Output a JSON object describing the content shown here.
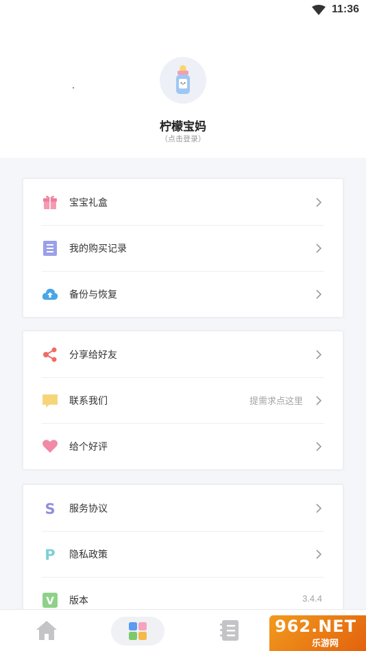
{
  "status_bar": {
    "time": "11:36"
  },
  "profile": {
    "name": "柠檬宝妈",
    "login_hint": "（点击登录）"
  },
  "groups": [
    {
      "items": [
        {
          "label": "宝宝礼盒",
          "icon": "gift-icon"
        },
        {
          "label": "我的购买记录",
          "icon": "purchase-record-icon"
        },
        {
          "label": "备份与恢复",
          "icon": "cloud-backup-icon"
        }
      ]
    },
    {
      "items": [
        {
          "label": "分享给好友",
          "icon": "share-icon"
        },
        {
          "label": "联系我们",
          "icon": "message-icon",
          "hint": "提需求点这里"
        },
        {
          "label": "给个好评",
          "icon": "heart-icon"
        }
      ]
    },
    {
      "items": [
        {
          "label": "服务协议",
          "icon": "service-agreement-icon",
          "icon_text": "S"
        },
        {
          "label": "隐私政策",
          "icon": "privacy-policy-icon",
          "icon_text": "P"
        },
        {
          "label": "版本",
          "icon": "version-icon",
          "icon_text": "V",
          "value": "3.4.4"
        }
      ]
    }
  ],
  "tabbar": {
    "tabs": [
      {
        "name": "home",
        "icon": "home-icon"
      },
      {
        "name": "apps",
        "icon": "grid-icon",
        "active": true
      },
      {
        "name": "notes",
        "icon": "notebook-icon"
      }
    ]
  },
  "watermark": {
    "top": "962.NET",
    "bottom": "乐游网"
  },
  "colors": {
    "accent_pink": "#f08aa6",
    "accent_blue": "#4aa6e8",
    "accent_purple": "#8f8fe0",
    "share_red": "#ef6b64",
    "message_yellow": "#f6d57a"
  }
}
